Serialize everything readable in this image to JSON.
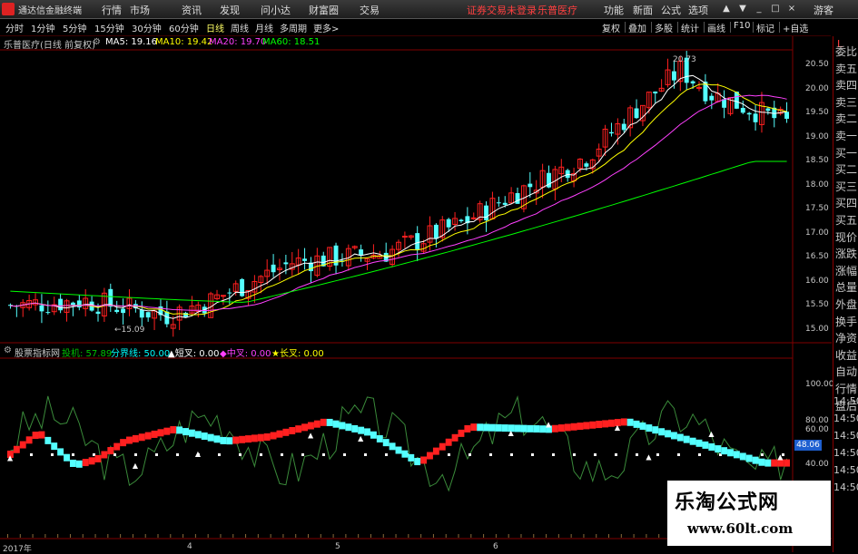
{
  "app": {
    "title": "通达信金融终端",
    "menu": [
      "行情",
      "市场",
      "资讯",
      "发现",
      "问小达",
      "财富圈",
      "交易"
    ],
    "promo": [
      "证券交易未登录",
      "乐普医疗"
    ],
    "right_menu": [
      "功能",
      "新面",
      "公式",
      "选项"
    ],
    "guest": "游客"
  },
  "periods": [
    "分时",
    "1分钟",
    "5分钟",
    "15分钟",
    "30分钟",
    "60分钟",
    "日线",
    "周线",
    "月线",
    "多周期",
    "更多>"
  ],
  "active_period": "日线",
  "right_tools": [
    "复权",
    "叠加",
    "多股",
    "统计",
    "画线",
    "F10",
    "标记",
    "+自选"
  ],
  "sidebar": {
    "top": "L",
    "items": [
      "委比",
      "卖五",
      "卖四",
      "卖三",
      "卖二",
      "卖一",
      "买一",
      "买二",
      "买三",
      "买四",
      "买五",
      "现价",
      "涨跌",
      "涨幅",
      "总量",
      "外盘",
      "换手",
      "净资",
      "收益",
      "自动",
      "行情",
      "盘后"
    ]
  },
  "main_info": {
    "stock": "乐普医疗(日线 前复权)",
    "ma": [
      {
        "label": "MA5: 19.16",
        "color": "#ffffff"
      },
      {
        "label": "MA10: 19.42",
        "color": "#ffff00"
      },
      {
        "label": "MA20: 19.70",
        "color": "#ff40ff"
      },
      {
        "label": "MA60: 18.51",
        "color": "#00ff00"
      }
    ]
  },
  "main_axis": {
    "ticks": [
      "20.50",
      "20.00",
      "19.50",
      "19.00",
      "18.50",
      "18.00",
      "17.50",
      "17.00",
      "16.50",
      "16.00",
      "15.50",
      "15.00"
    ],
    "high_label": "20.73",
    "low_label": "15.09"
  },
  "sub_info": {
    "name": "股票指标网",
    "items": [
      {
        "label": "投机: 57.89",
        "color": "#00c000"
      },
      {
        "label": "分界线: 50.00",
        "color": "#00ffff"
      },
      {
        "label": "▲短叉: 0.00",
        "color": "#ffffff"
      },
      {
        "label": "◆中叉: 0.00",
        "color": "#ff40ff"
      },
      {
        "label": "★长叉: 0.00",
        "color": "#ffff00"
      }
    ]
  },
  "sub_axis": {
    "ticks": [
      "100.00",
      "80.00",
      "60.00",
      "40.00"
    ],
    "current": "48.06"
  },
  "right_times": [
    "14:50",
    "14:50",
    "14:50",
    "14:50",
    "14:50",
    "14:50"
  ],
  "x_labels": [
    "2017年",
    "4",
    "5",
    "6"
  ],
  "watermark": {
    "cn": "乐淘公式网",
    "url": "www.60lt.com"
  },
  "colors": {
    "up": "#ff2020",
    "down": "#54ffff",
    "ma5": "#ffffff",
    "ma10": "#ffff00",
    "ma20": "#ff40ff",
    "ma60": "#00ff00"
  }
}
